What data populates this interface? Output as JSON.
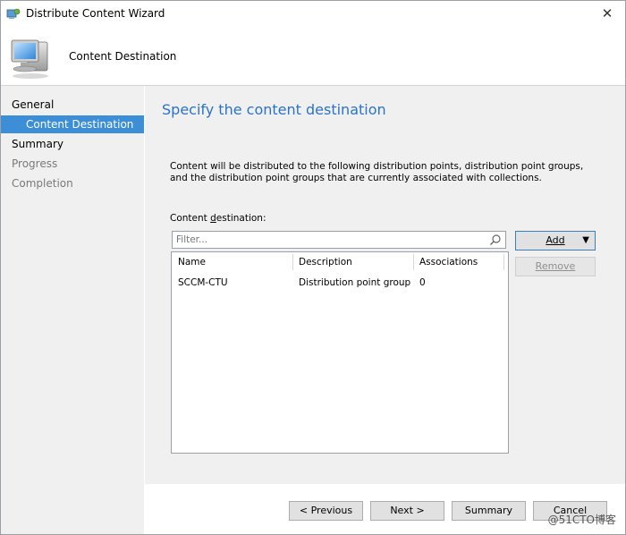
{
  "window": {
    "title": "Distribute Content Wizard",
    "close_glyph": "✕"
  },
  "header": {
    "page_title": "Content Destination"
  },
  "sidebar": {
    "items": [
      {
        "label": "General"
      },
      {
        "label": "Content Destination"
      },
      {
        "label": "Summary"
      },
      {
        "label": "Progress"
      },
      {
        "label": "Completion"
      }
    ]
  },
  "content": {
    "title": "Specify the content destination",
    "description": "Content will be distributed to the following distribution points, distribution point groups, and the distribution point groups that are currently associated with collections.",
    "dest_label_prefix": "Content ",
    "dest_label_underlined": "d",
    "dest_label_suffix": "estination:",
    "filter_placeholder": "Filter...",
    "table": {
      "columns": [
        "Name",
        "Description",
        "Associations"
      ],
      "rows": [
        {
          "name": "SCCM-CTU",
          "description": "Distribution point group",
          "associations": "0"
        }
      ]
    },
    "add_label": "Add",
    "add_caret": "▼",
    "remove_label": "Remove"
  },
  "footer": {
    "previous_label": "< Previous",
    "next_label": "Next >",
    "summary_label": "Summary",
    "cancel_label": "Cancel"
  },
  "watermark": "@51CTO博客",
  "colors": {
    "accent": "#3c8ed6",
    "title_blue": "#2b73c7"
  }
}
